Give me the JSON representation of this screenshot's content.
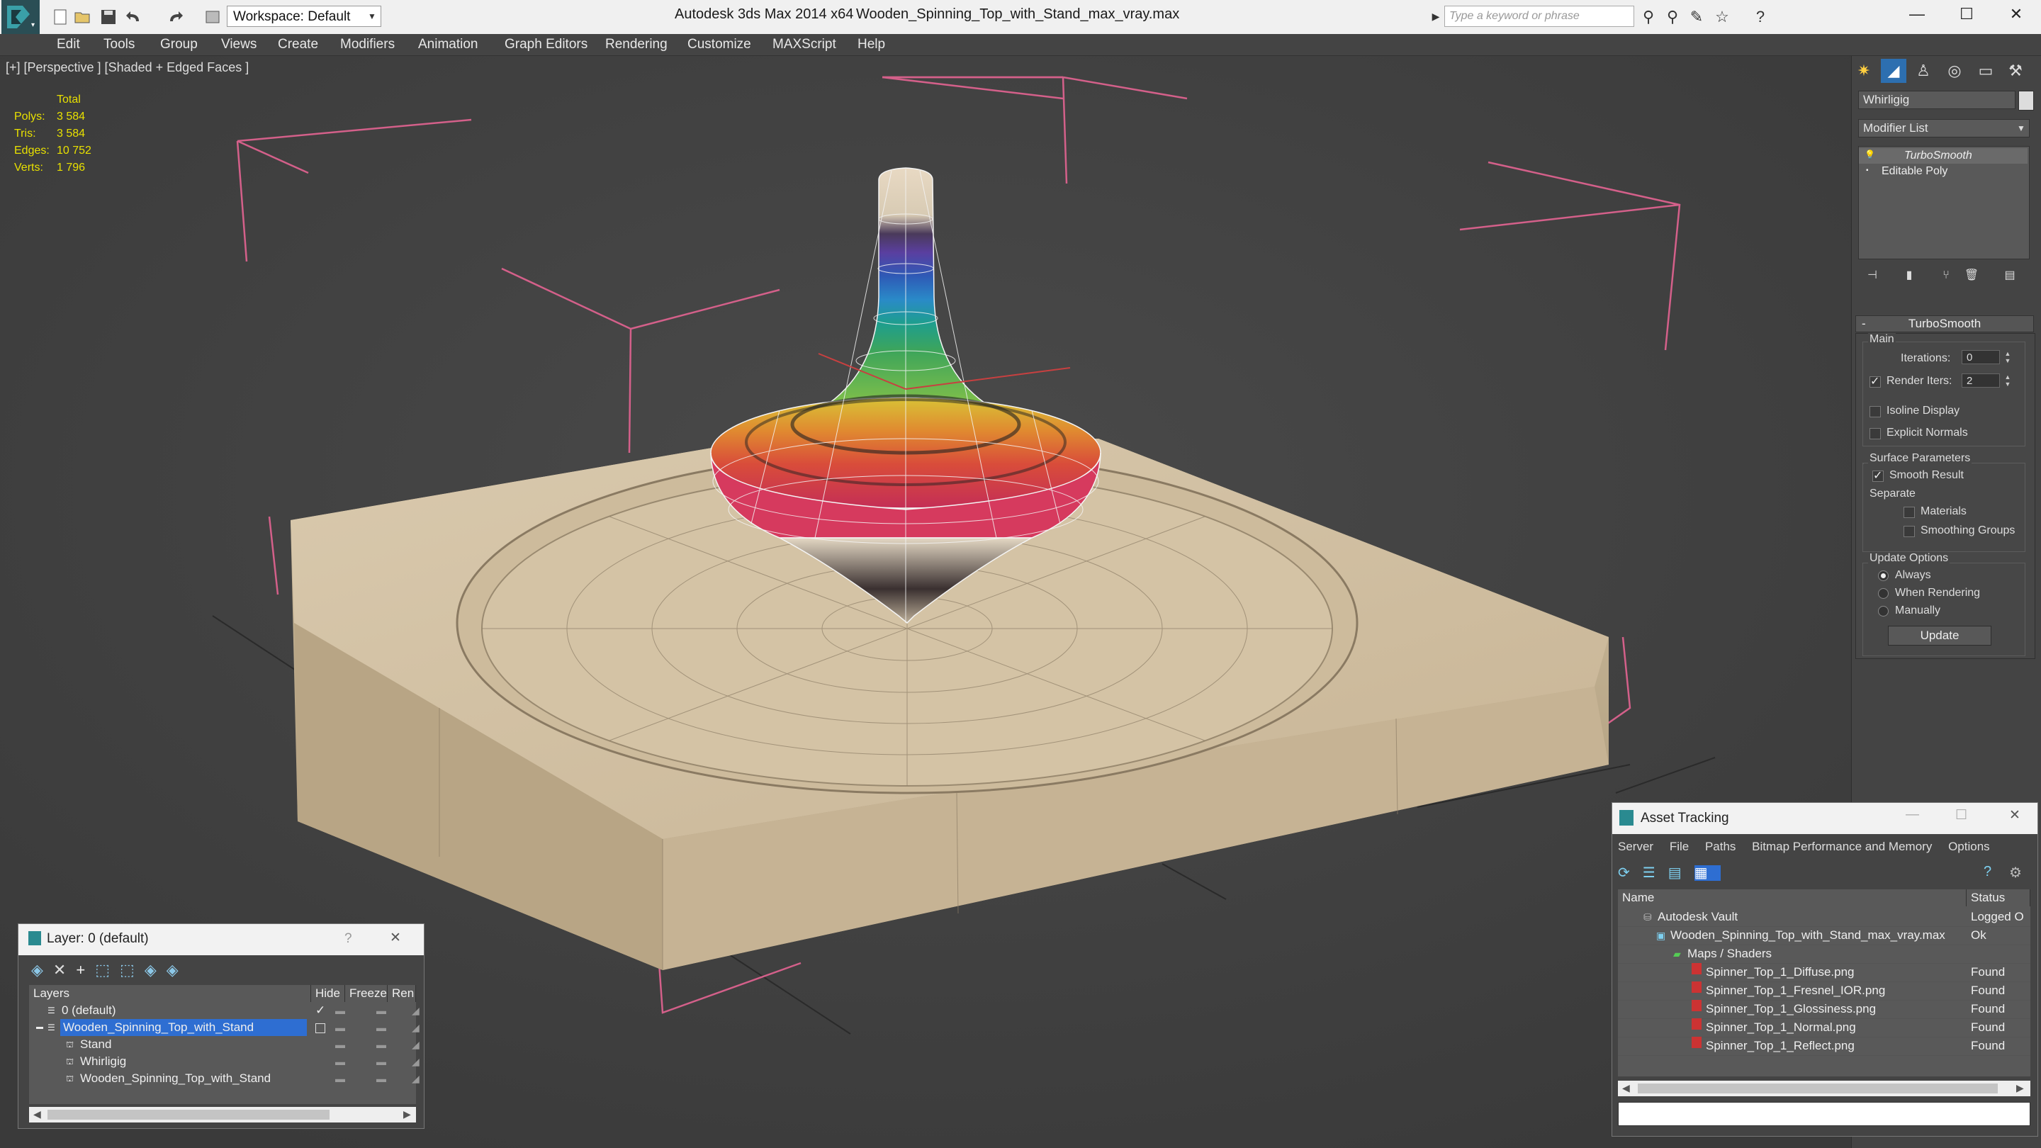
{
  "titlebar": {
    "workspace": "Workspace: Default",
    "app_title": "Autodesk 3ds Max  2014 x64",
    "file_title": "Wooden_Spinning_Top_with_Stand_max_vray.max",
    "search_placeholder": "Type a keyword or phrase"
  },
  "menu": [
    "Edit",
    "Tools",
    "Group",
    "Views",
    "Create",
    "Modifiers",
    "Animation",
    "Graph Editors",
    "Rendering",
    "Customize",
    "MAXScript",
    "Help"
  ],
  "viewport": {
    "label": "[+] [Perspective ] [Shaded + Edged Faces ]",
    "stats": {
      "header": "Total",
      "rows": [
        {
          "label": "Polys:",
          "value": "3 584"
        },
        {
          "label": "Tris:",
          "value": "3 584"
        },
        {
          "label": "Edges:",
          "value": "10 752"
        },
        {
          "label": "Verts:",
          "value": "1 796"
        }
      ]
    }
  },
  "command_panel": {
    "object_name": "Whirligig",
    "modifier_list": "Modifier List",
    "stack": [
      "TurboSmooth",
      "Editable Poly"
    ],
    "rollout_title": "TurboSmooth",
    "main_group": "Main",
    "iterations_label": "Iterations:",
    "iterations_value": "0",
    "render_iters_label": "Render Iters:",
    "render_iters_value": "2",
    "render_iters_checked": true,
    "isoline_display": "Isoline Display",
    "explicit_normals": "Explicit Normals",
    "surface_params": "Surface Parameters",
    "smooth_result": "Smooth Result",
    "separate": "Separate",
    "materials": "Materials",
    "smoothing_groups": "Smoothing Groups",
    "update_options": "Update Options",
    "always": "Always",
    "when_rendering": "When Rendering",
    "manually": "Manually",
    "update_button": "Update"
  },
  "layer_dialog": {
    "title": "Layer: 0 (default)",
    "help": "?",
    "close": "✕",
    "columns": [
      "Layers",
      "Hide",
      "Freeze",
      "Ren"
    ],
    "rows": [
      {
        "name": "0 (default)",
        "indent": 0,
        "selected": false
      },
      {
        "name": "Wooden_Spinning_Top_with_Stand",
        "indent": 0,
        "selected": true
      },
      {
        "name": "Stand",
        "indent": 1,
        "selected": false
      },
      {
        "name": "Whirligig",
        "indent": 1,
        "selected": false
      },
      {
        "name": "Wooden_Spinning_Top_with_Stand",
        "indent": 1,
        "selected": false
      }
    ]
  },
  "asset_tracking": {
    "title": "Asset Tracking",
    "menu": [
      "Server",
      "File",
      "Paths",
      "Bitmap Performance and Memory",
      "Options"
    ],
    "columns": [
      "Name",
      "Status"
    ],
    "rows": [
      {
        "name": "Autodesk Vault",
        "status": "Logged O",
        "indent": 1
      },
      {
        "name": "Wooden_Spinning_Top_with_Stand_max_vray.max",
        "status": "Ok",
        "indent": 2
      },
      {
        "name": "Maps / Shaders",
        "status": "",
        "indent": 3
      },
      {
        "name": "Spinner_Top_1_Diffuse.png",
        "status": "Found",
        "indent": 4
      },
      {
        "name": "Spinner_Top_1_Fresnel_IOR.png",
        "status": "Found",
        "indent": 4
      },
      {
        "name": "Spinner_Top_1_Glossiness.png",
        "status": "Found",
        "indent": 4
      },
      {
        "name": "Spinner_Top_1_Normal.png",
        "status": "Found",
        "indent": 4
      },
      {
        "name": "Spinner_Top_1_Reflect.png",
        "status": "Found",
        "indent": 4
      }
    ]
  }
}
